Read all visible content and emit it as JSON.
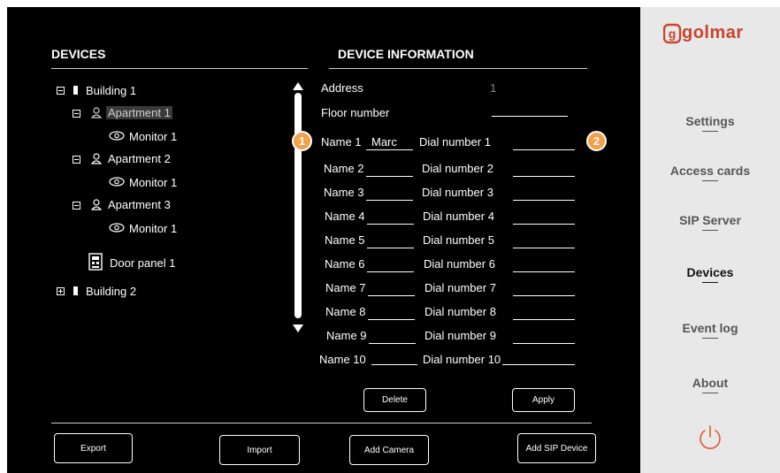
{
  "devices": {
    "title": "DEVICES",
    "tree": [
      {
        "label": "Building 1"
      },
      {
        "label": "Apartment 1"
      },
      {
        "label": "Monitor 1"
      },
      {
        "label": "Apartment 2"
      },
      {
        "label": "Monitor 1"
      },
      {
        "label": "Apartment 3"
      },
      {
        "label": "Monitor 1"
      },
      {
        "label": "Door panel 1"
      },
      {
        "label": "Building 2"
      }
    ]
  },
  "info": {
    "title": "DEVICE INFORMATION",
    "address_label": "Address",
    "address_value": "1",
    "floor_label": "Floor number",
    "rows": [
      {
        "name_label": "Name 1",
        "name_value": "Marc",
        "dial_label": "Dial number 1"
      },
      {
        "name_label": "Name 2",
        "name_value": "",
        "dial_label": "Dial number 2"
      },
      {
        "name_label": "Name 3",
        "name_value": "",
        "dial_label": "Dial number 3"
      },
      {
        "name_label": "Name 4",
        "name_value": "",
        "dial_label": "Dial number 4"
      },
      {
        "name_label": "Name 5",
        "name_value": "",
        "dial_label": "Dial number 5"
      },
      {
        "name_label": "Name 6",
        "name_value": "",
        "dial_label": "Dial number 6"
      },
      {
        "name_label": "Name 7",
        "name_value": "",
        "dial_label": "Dial number 7"
      },
      {
        "name_label": "Name 8",
        "name_value": "",
        "dial_label": "Dial number 8"
      },
      {
        "name_label": "Name 9",
        "name_value": "",
        "dial_label": "Dial number 9"
      },
      {
        "name_label": "Name 10",
        "name_value": "",
        "dial_label": "Dial number 10"
      }
    ],
    "delete_label": "Delete",
    "apply_label": "Apply"
  },
  "footer": {
    "export_label": "Export",
    "import_label": "Import",
    "add_camera_label": "Add Camera",
    "add_sip_label": "Add SIP Device"
  },
  "sidebar": {
    "logo": "golmar",
    "items": [
      {
        "label": "Settings"
      },
      {
        "label": "Access cards"
      },
      {
        "label": "SIP Server"
      },
      {
        "label": "Devices"
      },
      {
        "label": "Event log"
      },
      {
        "label": "About"
      }
    ],
    "active": "Devices"
  },
  "callouts": [
    "1",
    "2"
  ],
  "colors": {
    "accent": "#f2a04a",
    "logo": "#c8442c",
    "panel_bg": "#000000",
    "sidebar_bg": "#e8e8e8"
  }
}
